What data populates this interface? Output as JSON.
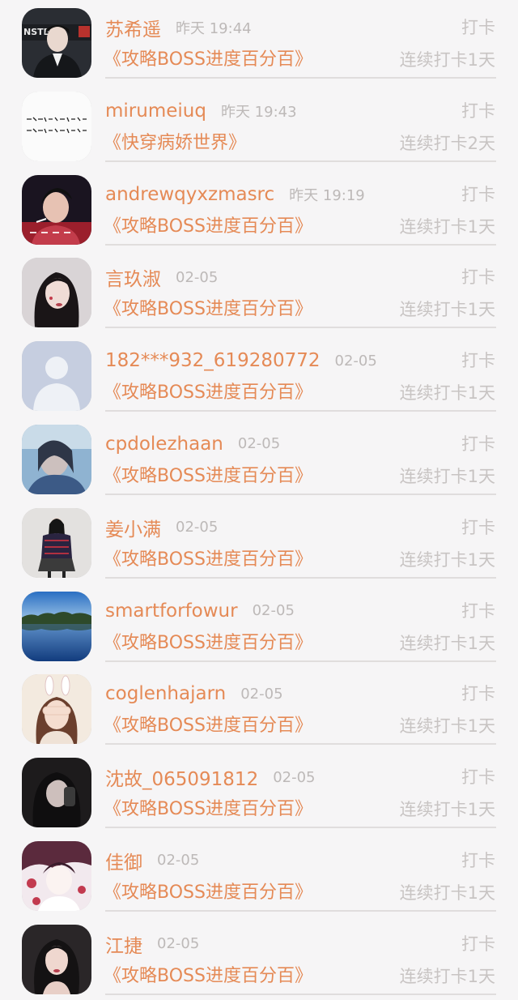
{
  "colors": {
    "background": "#f6f5f6",
    "accent": "#e58a56",
    "muted": "#c8c4c3",
    "divider": "#e0dddd"
  },
  "entries": [
    {
      "name": "苏希遥",
      "time": "昨天 19:44",
      "checkin": "打卡",
      "book": "《攻略BOSS进度百分百》",
      "streak": "连续打卡1天",
      "avatar_label": "NSTEI",
      "avatar": "person-icon"
    },
    {
      "name": "mirumeiuq",
      "time": "昨天 19:43",
      "checkin": "打卡",
      "book": "《快穿病娇世界》",
      "streak": "连续打卡2天",
      "avatar": "person-icon"
    },
    {
      "name": "andrewqyxzmasrc",
      "time": "昨天 19:19",
      "checkin": "打卡",
      "book": "《攻略BOSS进度百分百》",
      "streak": "连续打卡1天",
      "avatar": "person-icon"
    },
    {
      "name": "言玖淑",
      "time": "02-05",
      "checkin": "打卡",
      "book": "《攻略BOSS进度百分百》",
      "streak": "连续打卡1天",
      "avatar": "person-icon"
    },
    {
      "name": "182***932_619280772",
      "time": "02-05",
      "checkin": "打卡",
      "book": "《攻略BOSS进度百分百》",
      "streak": "连续打卡1天",
      "avatar": "default-avatar-icon"
    },
    {
      "name": "cpdolezhaan",
      "time": "02-05",
      "checkin": "打卡",
      "book": "《攻略BOSS进度百分百》",
      "streak": "连续打卡1天",
      "avatar": "person-icon"
    },
    {
      "name": "姜小满",
      "time": "02-05",
      "checkin": "打卡",
      "book": "《攻略BOSS进度百分百》",
      "streak": "连续打卡1天",
      "avatar": "person-icon"
    },
    {
      "name": "smartforfowur",
      "time": "02-05",
      "checkin": "打卡",
      "book": "《攻略BOSS进度百分百》",
      "streak": "连续打卡1天",
      "avatar": "landscape-icon"
    },
    {
      "name": "coglenhajarn",
      "time": "02-05",
      "checkin": "打卡",
      "book": "《攻略BOSS进度百分百》",
      "streak": "连续打卡1天",
      "avatar": "person-icon"
    },
    {
      "name": "沈故_065091812",
      "time": "02-05",
      "checkin": "打卡",
      "book": "《攻略BOSS进度百分百》",
      "streak": "连续打卡1天",
      "avatar": "person-icon"
    },
    {
      "name": "佳御",
      "time": "02-05",
      "checkin": "打卡",
      "book": "《攻略BOSS进度百分百》",
      "streak": "连续打卡1天",
      "avatar": "person-icon"
    },
    {
      "name": "江捷",
      "time": "02-05",
      "checkin": "打卡",
      "book": "《攻略BOSS进度百分百》",
      "streak": "连续打卡1天",
      "avatar": "person-icon"
    }
  ]
}
